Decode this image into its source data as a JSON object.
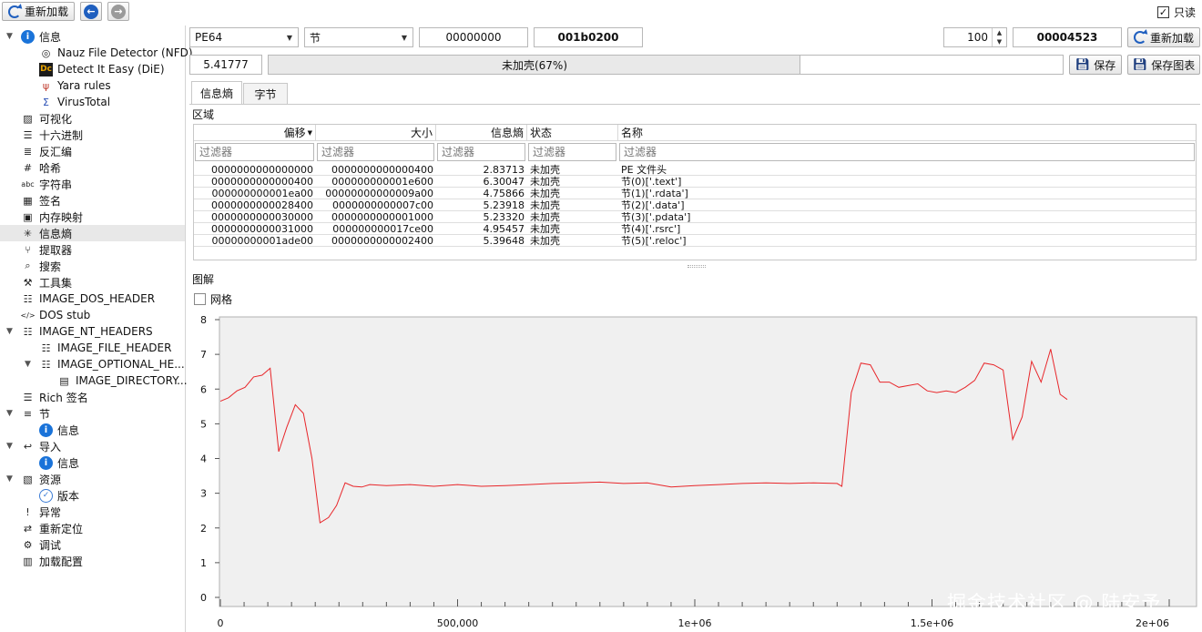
{
  "toolbar": {
    "reload_label": "重新加载",
    "readonly_label": "只读",
    "readonly_checked": true
  },
  "sidebar": {
    "items": [
      {
        "label": "信息",
        "icon": "info-icon",
        "level": 0,
        "expanded": true
      },
      {
        "label": "Nauz File Detector (NFD)",
        "icon": "nfd-icon",
        "level": 1
      },
      {
        "label": "Detect It Easy (DiE)",
        "icon": "die-icon",
        "level": 1
      },
      {
        "label": "Yara rules",
        "icon": "yara-icon",
        "level": 1
      },
      {
        "label": "VirusTotal",
        "icon": "virustotal-icon",
        "level": 1
      },
      {
        "label": "可视化",
        "icon": "image-icon",
        "level": 0
      },
      {
        "label": "十六进制",
        "icon": "hex-icon",
        "level": 0
      },
      {
        "label": "反汇编",
        "icon": "disasm-icon",
        "level": 0
      },
      {
        "label": "哈希",
        "icon": "hash-icon",
        "level": 0
      },
      {
        "label": "字符串",
        "icon": "strings-icon",
        "level": 0
      },
      {
        "label": "签名",
        "icon": "signature-icon",
        "level": 0
      },
      {
        "label": "内存映射",
        "icon": "memory-icon",
        "level": 0
      },
      {
        "label": "信息熵",
        "icon": "entropy-icon",
        "level": 0,
        "selected": true
      },
      {
        "label": "提取器",
        "icon": "extractor-icon",
        "level": 0
      },
      {
        "label": "搜索",
        "icon": "search-icon",
        "level": 0
      },
      {
        "label": "工具集",
        "icon": "wrench-icon",
        "level": 0
      },
      {
        "label": "IMAGE_DOS_HEADER",
        "icon": "header-icon",
        "level": 0
      },
      {
        "label": "DOS stub",
        "icon": "code-icon",
        "level": 0
      },
      {
        "label": "IMAGE_NT_HEADERS",
        "icon": "header-icon",
        "level": 0,
        "expanded": true
      },
      {
        "label": "IMAGE_FILE_HEADER",
        "icon": "header-icon",
        "level": 1
      },
      {
        "label": "IMAGE_OPTIONAL_HE...",
        "icon": "header-icon",
        "level": 1,
        "expanded": true
      },
      {
        "label": "IMAGE_DIRECTORY...",
        "icon": "table-icon",
        "level": 2
      },
      {
        "label": "Rich 签名",
        "icon": "list-icon",
        "level": 0
      },
      {
        "label": "节",
        "icon": "sections-icon",
        "level": 0,
        "expanded": true
      },
      {
        "label": "信息",
        "icon": "info-icon",
        "level": 1
      },
      {
        "label": "导入",
        "icon": "import-icon",
        "level": 0,
        "expanded": true
      },
      {
        "label": "信息",
        "icon": "info-icon",
        "level": 1
      },
      {
        "label": "资源",
        "icon": "resource-icon",
        "level": 0,
        "expanded": true
      },
      {
        "label": "版本",
        "icon": "version-icon",
        "level": 1
      },
      {
        "label": "异常",
        "icon": "exception-icon",
        "level": 0
      },
      {
        "label": "重新定位",
        "icon": "relocation-icon",
        "level": 0
      },
      {
        "label": "调试",
        "icon": "debug-icon",
        "level": 0
      },
      {
        "label": "加载配置",
        "icon": "loadconfig-icon",
        "level": 0
      }
    ]
  },
  "controls": {
    "type_select": "PE64",
    "region_select": "节",
    "offset": "00000000",
    "size": "001b0200",
    "count": "100",
    "result": "00004523",
    "reload_label": "重新加载",
    "entropy_value": "5.41777",
    "status_text": "未加壳(67%)",
    "status_fraction": 0.67,
    "save_label": "保存",
    "save_chart_label": "保存图表"
  },
  "tabs": [
    {
      "label": "信息熵",
      "active": true
    },
    {
      "label": "字节",
      "active": false
    }
  ],
  "regions": {
    "section_label": "区域",
    "columns": [
      "偏移",
      "大小",
      "信息熵",
      "状态",
      "名称"
    ],
    "filter_placeholder": "过滤器",
    "rows": [
      [
        "0000000000000000",
        "0000000000000400",
        "2.83713",
        "未加壳",
        "PE 文件头"
      ],
      [
        "0000000000000400",
        "000000000001e600",
        "6.30047",
        "未加壳",
        "节(0)['.text']"
      ],
      [
        "000000000001ea00",
        "00000000000009a00",
        "4.75866",
        "未加壳",
        "节(1)['.rdata']"
      ],
      [
        "0000000000028400",
        "0000000000007c00",
        "5.23918",
        "未加壳",
        "节(2)['.data']"
      ],
      [
        "0000000000030000",
        "0000000000001000",
        "5.23320",
        "未加壳",
        "节(3)['.pdata']"
      ],
      [
        "0000000000031000",
        "000000000017ce00",
        "4.95457",
        "未加壳",
        "节(4)['.rsrc']"
      ],
      [
        "00000000001ade00",
        "0000000000002400",
        "5.39648",
        "未加壳",
        "节(5)['.reloc']"
      ]
    ]
  },
  "diagram": {
    "section_label": "图解",
    "grid_label": "网格",
    "grid_checked": false
  },
  "watermark": "掘金技术社区 @ 陆安予",
  "chart_data": {
    "type": "line",
    "xlim": [
      0,
      2000000
    ],
    "ylim": [
      0,
      8
    ],
    "x_ticks": [
      0,
      500000,
      1000000,
      1500000,
      2000000
    ],
    "x_tick_labels": [
      "0",
      "500,000",
      "1e+06",
      "1.5e+06",
      "2e+06"
    ],
    "y_ticks": [
      0,
      1,
      2,
      3,
      4,
      5,
      6,
      7,
      8
    ],
    "y_tick_labels": [
      "0",
      "1",
      "2",
      "3",
      "4",
      "5",
      "6",
      "7",
      "8"
    ],
    "grid": false,
    "line_color": "#e8262a",
    "series": [
      {
        "x": [
          0,
          17000,
          35000,
          52000,
          70000,
          88000,
          105000,
          123000,
          140000,
          158000,
          175000,
          193000,
          210000,
          228000,
          245000,
          263000,
          280000,
          298000,
          315000,
          350000,
          400000,
          450000,
          500000,
          550000,
          600000,
          650000,
          700000,
          750000,
          800000,
          850000,
          900000,
          950000,
          1000000,
          1050000,
          1100000,
          1150000,
          1200000,
          1250000,
          1300000,
          1310000,
          1330000,
          1350000,
          1370000,
          1390000,
          1410000,
          1430000,
          1450000,
          1470000,
          1490000,
          1510000,
          1530000,
          1550000,
          1570000,
          1590000,
          1610000,
          1630000,
          1650000,
          1670000,
          1690000,
          1710000,
          1730000,
          1750000,
          1770000,
          1785000
        ],
        "y": [
          5.65,
          5.75,
          5.95,
          6.05,
          6.35,
          6.4,
          6.6,
          4.2,
          4.9,
          5.55,
          5.3,
          4.0,
          2.15,
          2.3,
          2.65,
          3.3,
          3.2,
          3.18,
          3.25,
          3.22,
          3.25,
          3.2,
          3.25,
          3.2,
          3.22,
          3.25,
          3.28,
          3.3,
          3.32,
          3.28,
          3.3,
          3.18,
          3.22,
          3.25,
          3.28,
          3.3,
          3.28,
          3.3,
          3.28,
          3.2,
          5.9,
          6.75,
          6.7,
          6.2,
          6.2,
          6.05,
          6.1,
          6.15,
          5.95,
          5.9,
          5.95,
          5.9,
          6.05,
          6.25,
          6.75,
          6.7,
          6.55,
          4.55,
          5.2,
          6.8,
          6.2,
          7.15,
          5.85,
          5.7
        ]
      }
    ]
  }
}
